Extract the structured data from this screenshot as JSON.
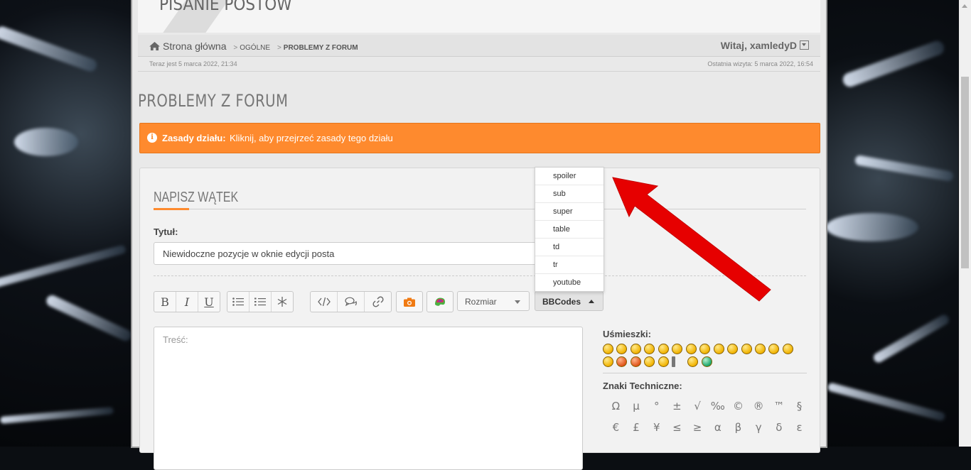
{
  "banner": {
    "title": "PISANIE POSTÓW"
  },
  "nav": {
    "home": "Strona główna",
    "crumb1": "OGÓLNE",
    "crumb2": "PROBLEMY Z FORUM",
    "welcome": "Witaj, xamledyD"
  },
  "info": {
    "now": "Teraz jest 5 marca 2022, 21:34",
    "last_visit": "Ostatnia wizyta: 5 marca 2022, 16:54"
  },
  "forum_title": "PROBLEMY Z FORUM",
  "rules": {
    "label": "Zasady działu:",
    "text": "Kliknij, aby przejrzeć zasady tego działu"
  },
  "form": {
    "heading": "NAPISZ WĄTEK",
    "title_label": "Tytuł:",
    "title_value": "Niewidoczne pozycje w oknie edycji posta",
    "content_placeholder": "Treść:",
    "size_select": "Rozmiar",
    "bbcodes_select": "BBCodes"
  },
  "toolbar": {
    "bold": "B",
    "italic": "I",
    "underline": "U"
  },
  "bbcodes_menu": [
    "spoiler",
    "sub",
    "super",
    "table",
    "td",
    "tr",
    "youtube"
  ],
  "side": {
    "smileys_label": "Uśmieszki:",
    "chars_label": "Znaki Techniczne:",
    "chars": [
      "Ω",
      "µ",
      "°",
      "±",
      "√",
      "‰",
      "©",
      "®",
      "™",
      "§",
      "€",
      "£",
      "¥",
      "≤",
      "≥",
      "α",
      "β",
      "γ",
      "δ",
      "ε"
    ]
  },
  "colors": {
    "accent": "#fe8a2e",
    "arrow": "#e60000"
  }
}
